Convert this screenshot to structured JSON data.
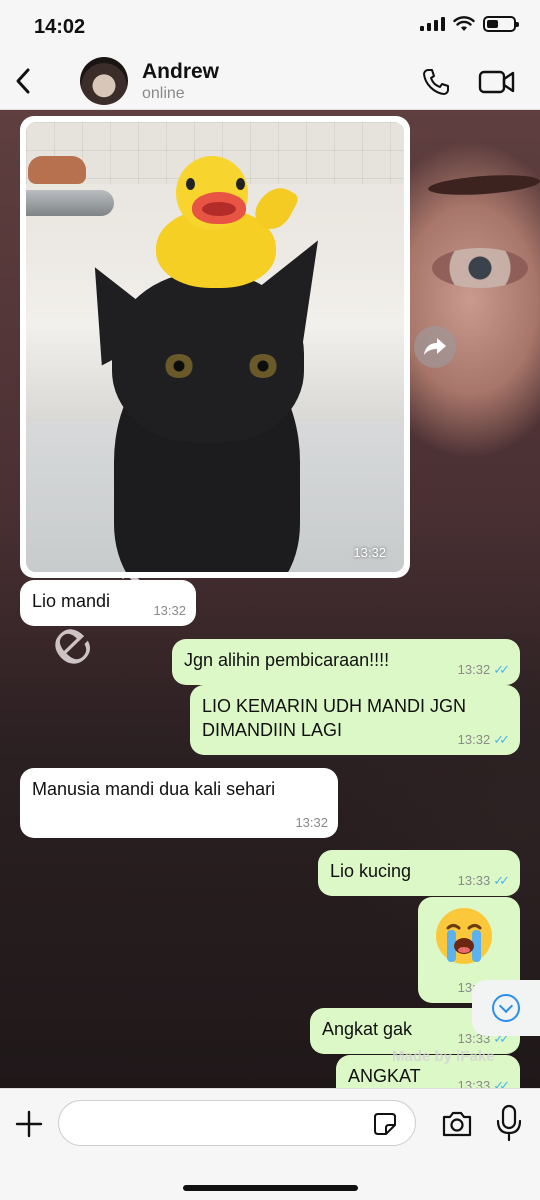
{
  "status_bar": {
    "time": "14:02",
    "battery_level": 0.45
  },
  "header": {
    "contact_name": "Andrew",
    "contact_status": "online"
  },
  "background": {
    "text": "e cross"
  },
  "messages": [
    {
      "direction": "in",
      "type": "image",
      "image_subject": "black cat with yellow rubber duck on head",
      "time": "13:32"
    },
    {
      "direction": "in",
      "text": "Lio mandi",
      "time": "13:32"
    },
    {
      "direction": "out",
      "text": "Jgn alihin pembicaraan!!!!",
      "time": "13:32",
      "read": true
    },
    {
      "direction": "out",
      "text": "LIO KEMARIN UDH MANDI JGN\nDIMANDIIN LAGI",
      "time": "13:32",
      "read": true
    },
    {
      "direction": "in",
      "text": "Manusia mandi dua kali sehari",
      "time": "13:32"
    },
    {
      "direction": "out",
      "text": "Lio kucing",
      "time": "13:33",
      "read": true
    },
    {
      "direction": "out",
      "type": "emoji",
      "emoji": "😭",
      "time": "13:33",
      "read": true
    },
    {
      "direction": "out",
      "text": "Angkat gak",
      "time": "13:33",
      "read": true
    },
    {
      "direction": "out",
      "text": "ANGKAT",
      "time": "13:33",
      "read": true
    }
  ],
  "watermark": "Made by iFake",
  "composer": {
    "placeholder": ""
  },
  "icons": {
    "back": "chevron-left-icon",
    "call": "phone-icon",
    "video": "video-camera-icon",
    "forward": "forward-icon",
    "scroll_down": "chevron-down-circle-icon",
    "attach": "plus-icon",
    "sticker": "sticker-icon",
    "camera": "camera-icon",
    "mic": "microphone-icon"
  },
  "colors": {
    "outgoing_bubble": "#dcf8c6",
    "incoming_bubble": "#ffffff",
    "read_ticks": "#4fb6ec",
    "accent": "#2b8fe8"
  }
}
